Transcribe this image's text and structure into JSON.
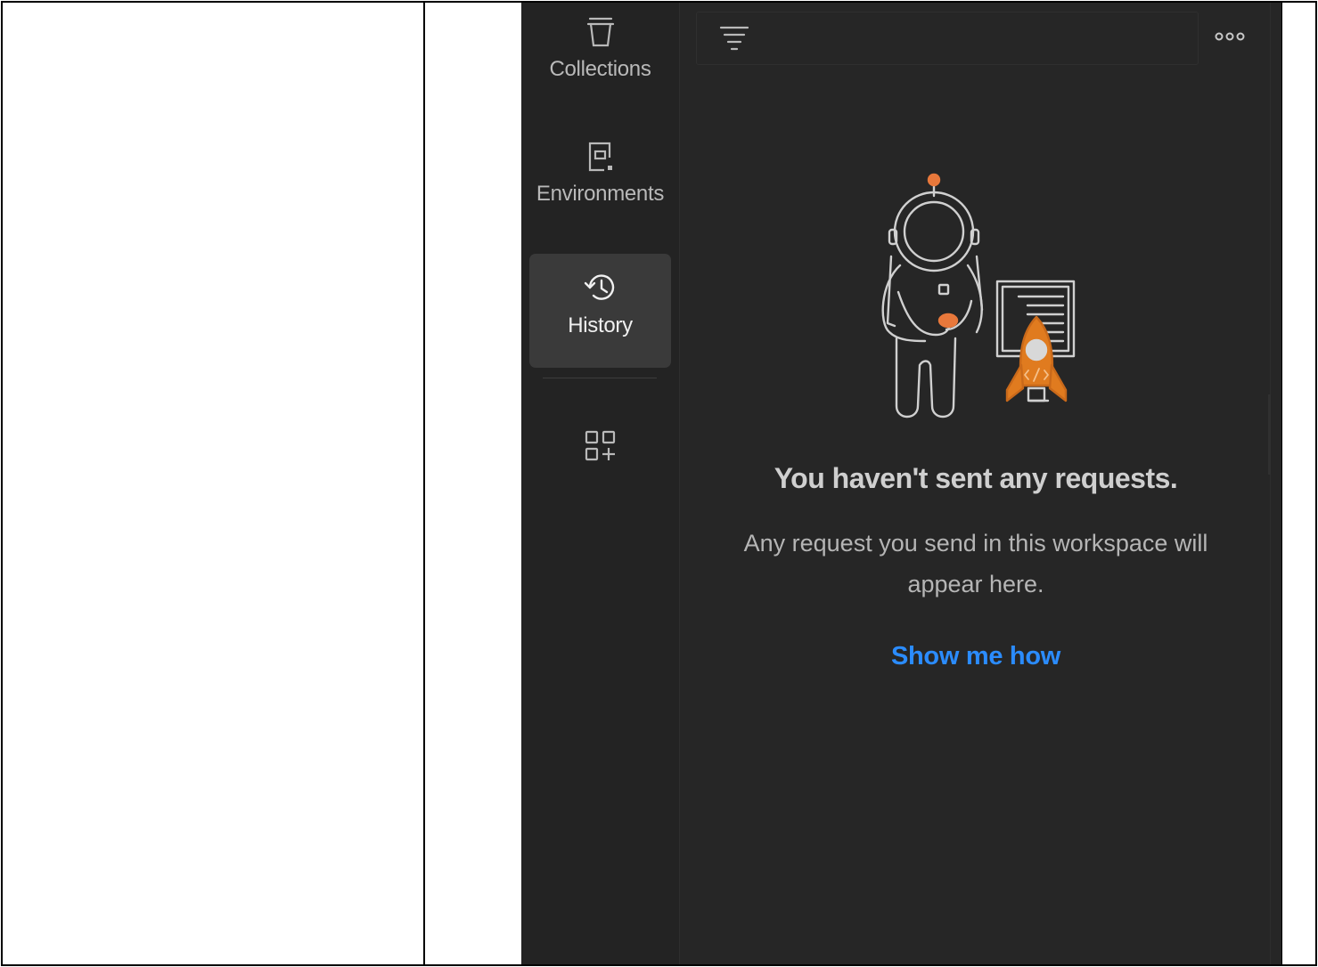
{
  "sidebar": {
    "items": [
      {
        "id": "collections",
        "label": "Collections",
        "icon": "trash-can-icon",
        "active": false
      },
      {
        "id": "environments",
        "label": "Environments",
        "icon": "environment-icon",
        "active": false
      },
      {
        "id": "history",
        "label": "History",
        "icon": "history-icon",
        "active": true
      }
    ],
    "configure_icon": "apps-plus-icon"
  },
  "main": {
    "filter_icon": "filter-icon",
    "more_icon": "more-horizontal-icon",
    "empty_state": {
      "title": "You haven't sent any requests.",
      "description": "Any request you send in this workspace will appear here.",
      "link": "Show me how"
    }
  },
  "colors": {
    "background": "#262626",
    "sidebar": "#232323",
    "active_item": "#3a3a3a",
    "link": "#2b8cff",
    "rocket": "#e07b1f"
  }
}
